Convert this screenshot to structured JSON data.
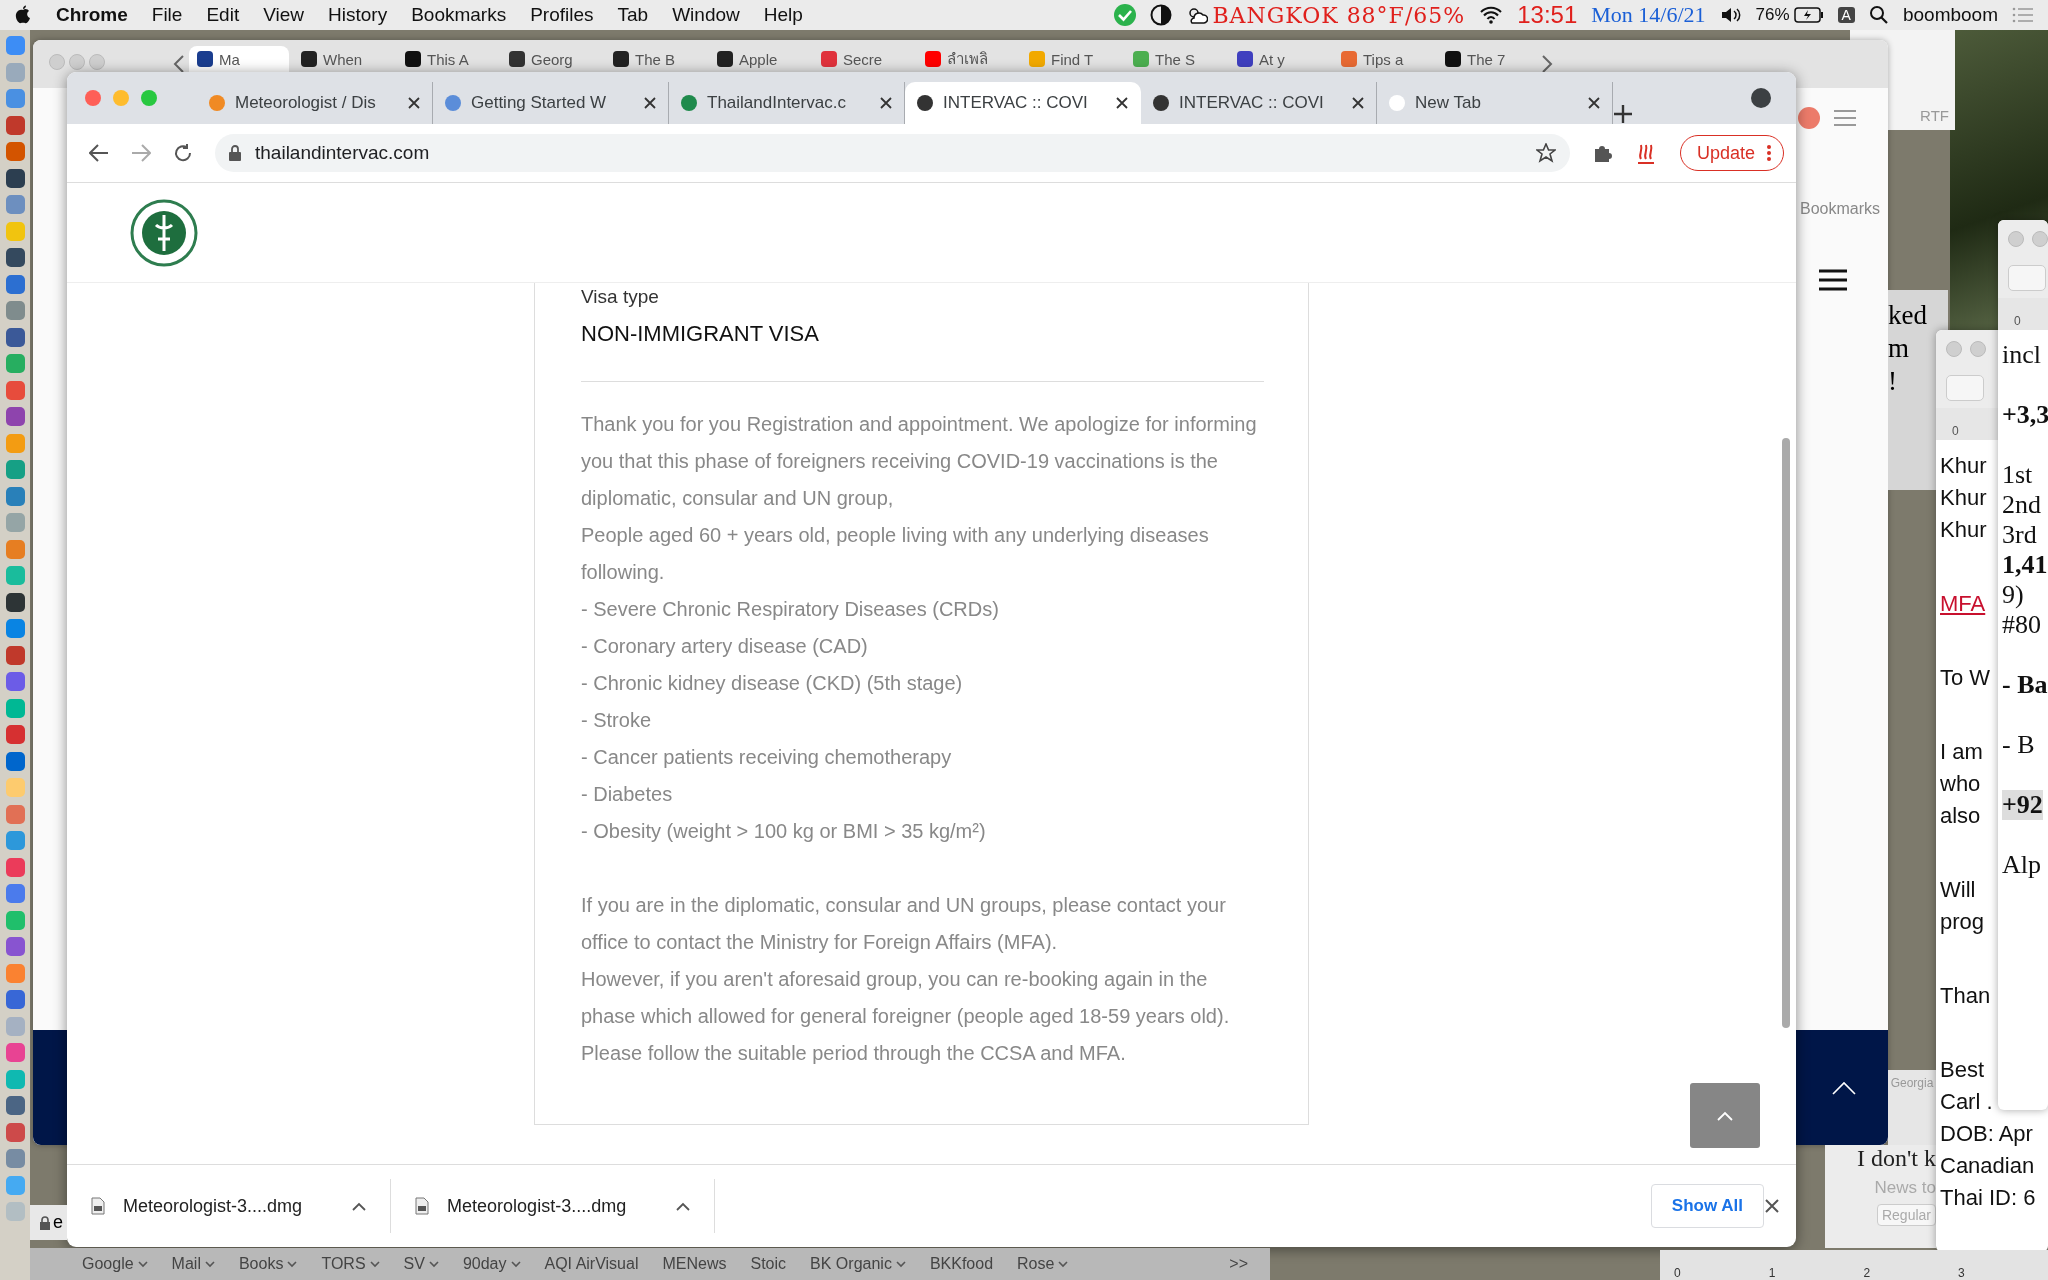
{
  "menu_bar": {
    "app": "Chrome",
    "menus": [
      "File",
      "Edit",
      "View",
      "History",
      "Bookmarks",
      "Profiles",
      "Tab",
      "Window",
      "Help"
    ],
    "weather": "BANGKOK 88°F/65%",
    "time": "13:51",
    "date": "Mon 14/6/21",
    "battery": "76%",
    "input_source": "A",
    "user": "boomboom"
  },
  "back_window": {
    "tabs": [
      {
        "label": "Ma",
        "color": "#1a3d8f",
        "selected": true
      },
      {
        "label": "When",
        "color": "#222222",
        "selected": false
      },
      {
        "label": "This A",
        "color": "#111111",
        "selected": false
      },
      {
        "label": "Georg",
        "color": "#333333",
        "selected": false
      },
      {
        "label": "The B",
        "color": "#222222",
        "selected": false
      },
      {
        "label": "Apple",
        "color": "#222222",
        "selected": false
      },
      {
        "label": "Secre",
        "color": "#e0323c",
        "selected": false
      },
      {
        "label": "ลำเพลิ",
        "color": "#ff0000",
        "selected": false
      },
      {
        "label": "Find T",
        "color": "#f2a900",
        "selected": false
      },
      {
        "label": "The S",
        "color": "#4caf50",
        "selected": false
      },
      {
        "label": "At y",
        "color": "#3f3fbf",
        "selected": false
      },
      {
        "label": "Tips a",
        "color": "#e86a33",
        "selected": false
      },
      {
        "label": "The 7",
        "color": "#111111",
        "selected": false
      }
    ],
    "bookmarks_label": "Bookmarks"
  },
  "browser": {
    "tabs": [
      {
        "label": "Meteorologist / Dis",
        "color": "#f08a24",
        "selected": false
      },
      {
        "label": "Getting Started W",
        "color": "#5b8dd9",
        "selected": false
      },
      {
        "label": "ThailandIntervac.c",
        "color": "#1f8a4c",
        "selected": false
      },
      {
        "label": "INTERVAC :: COVI",
        "color": "#333333",
        "selected": true
      },
      {
        "label": "INTERVAC :: COVI",
        "color": "#333333",
        "selected": false
      },
      {
        "label": "New Tab",
        "color": "#ffffff",
        "selected": false
      }
    ],
    "url": "thailandintervac.com",
    "update_button": "Update",
    "page": {
      "visa_label": "Visa type",
      "visa_type": "NON-IMMIGRANT VISA",
      "intro": [
        "Thank you for you Registration and appointment. We apologize for informing you that this phase of foreigners receiving COVID-19 vaccinations is the diplomatic, consular and UN group,",
        "People aged 60 + years old, people living with any underlying diseases following."
      ],
      "conditions": [
        "- Severe Chronic Respiratory Diseases (CRDs)",
        "- Coronary artery disease (CAD)",
        "- Chronic kidney disease (CKD) (5th stage)",
        "- Stroke",
        "- Cancer patients receiving chemotherapy",
        "- Diabetes",
        "- Obesity (weight > 100 kg or BMI > 35 kg/m²)"
      ],
      "notes": [
        "If you are in the diplomatic, consular and UN groups, please contact your office to contact the Ministry for Foreign Affairs (MFA).",
        "However, if you aren't aforesaid group, you can re-booking again in the phase which allowed for general foreigner (people aged 18-59 years old).",
        "Please follow the suitable period through the CCSA and MFA."
      ]
    },
    "downloads": [
      {
        "filename": "Meteorologist-3....dmg"
      },
      {
        "filename": "Meteorologist-3....dmg"
      }
    ],
    "show_all": "Show All"
  },
  "bookmarks_bar": [
    {
      "label": "Google",
      "menu": true
    },
    {
      "label": "Mail",
      "menu": true
    },
    {
      "label": "Books",
      "menu": true
    },
    {
      "label": "TORS",
      "menu": true
    },
    {
      "label": "SV",
      "menu": true
    },
    {
      "label": "90day",
      "menu": true
    },
    {
      "label": "AQI AirVisual",
      "menu": false
    },
    {
      "label": "MENews",
      "menu": false
    },
    {
      "label": "Stoic",
      "menu": false
    },
    {
      "label": "BK Organic",
      "menu": true
    },
    {
      "label": "BKKfood",
      "menu": false
    },
    {
      "label": "Rose",
      "menu": true
    }
  ],
  "bookmarks_overflow": ">>",
  "partial_address": "e",
  "rtf_label": "RTF",
  "doc_fragments": [
    "ked",
    "m",
    "!"
  ],
  "pages_window": {
    "font": "Georgia",
    "text": "I don't k",
    "file": "News to",
    "style": "Regular"
  },
  "doc_a": {
    "ruler": "0",
    "paragraphs": [
      [
        {
          "text": "Khur"
        },
        {
          "text": "Khur"
        },
        {
          "text": "Khur"
        }
      ],
      [
        {
          "text": "MFA",
          "kind": "link"
        }
      ],
      [
        {
          "text": "To W"
        }
      ],
      [
        {
          "text": "I am"
        },
        {
          "text": "who"
        },
        {
          "text": "also"
        }
      ],
      [
        {
          "text": "Will"
        },
        {
          "text": "prog"
        }
      ],
      [
        {
          "text": "Than"
        }
      ],
      [
        {
          "text": "Best"
        },
        {
          "text": "Carl ."
        },
        {
          "text": "DOB: Apr"
        },
        {
          "text": "Canadian"
        },
        {
          "text": "Thai ID: 6"
        }
      ]
    ]
  },
  "doc_b": {
    "ruler": "0",
    "paragraphs": [
      [
        {
          "text": "incl",
          "bold": false
        }
      ],
      [
        {
          "text": "+3,3",
          "bold": true
        }
      ],
      [
        {
          "text": "1st",
          "bold": false
        },
        {
          "text": "2nd",
          "bold": false
        },
        {
          "text": "3rd",
          "bold": false
        },
        {
          "text": "1,41",
          "bold": true
        },
        {
          "text": "9)",
          "bold": false
        },
        {
          "text": "#80",
          "bold": false
        }
      ],
      [
        {
          "text": "- Ba",
          "bold": true
        }
      ],
      [
        {
          "text": "- B",
          "bold": false
        }
      ],
      [
        {
          "text": "+92",
          "bold": true,
          "highlighted": true
        }
      ],
      [
        {
          "text": "Alp",
          "bold": false
        }
      ]
    ]
  },
  "bottom_ruler": [
    "0",
    "1",
    "2",
    "3"
  ]
}
